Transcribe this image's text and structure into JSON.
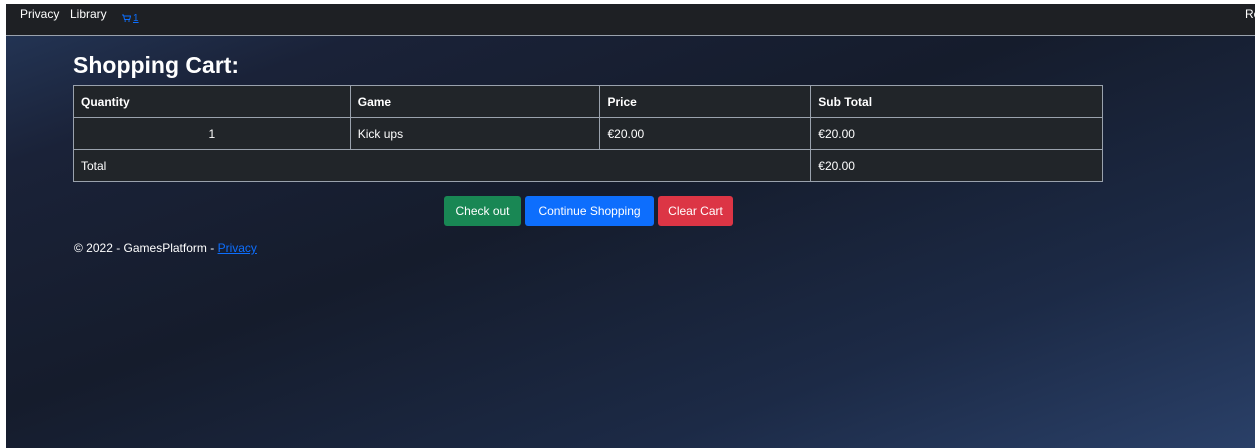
{
  "navbar": {
    "links": [
      "Privacy",
      "Library"
    ],
    "cart_icon": "shopping-cart-icon",
    "cart_count": "1",
    "right_text": "Re"
  },
  "main": {
    "title": "Shopping Cart:",
    "table": {
      "headers": [
        "Quantity",
        "Game",
        "Price",
        "Sub Total"
      ],
      "rows": [
        [
          "1",
          "Kick ups",
          "€20.00",
          "€20.00"
        ]
      ],
      "total_label": "Total",
      "total_value": "€20.00"
    },
    "buttons": {
      "checkout": "Check out",
      "continue": "Continue Shopping",
      "clear": "Clear Cart"
    }
  },
  "footer": {
    "text": "© 2022 - GamesPlatform - ",
    "privacy_link": "Privacy"
  },
  "colors": {
    "navbar_bg": "#1e2024",
    "table_bg": "#212529",
    "success": "#198754",
    "primary": "#0d6efd",
    "danger": "#dc3545",
    "link": "#0d6efd"
  }
}
